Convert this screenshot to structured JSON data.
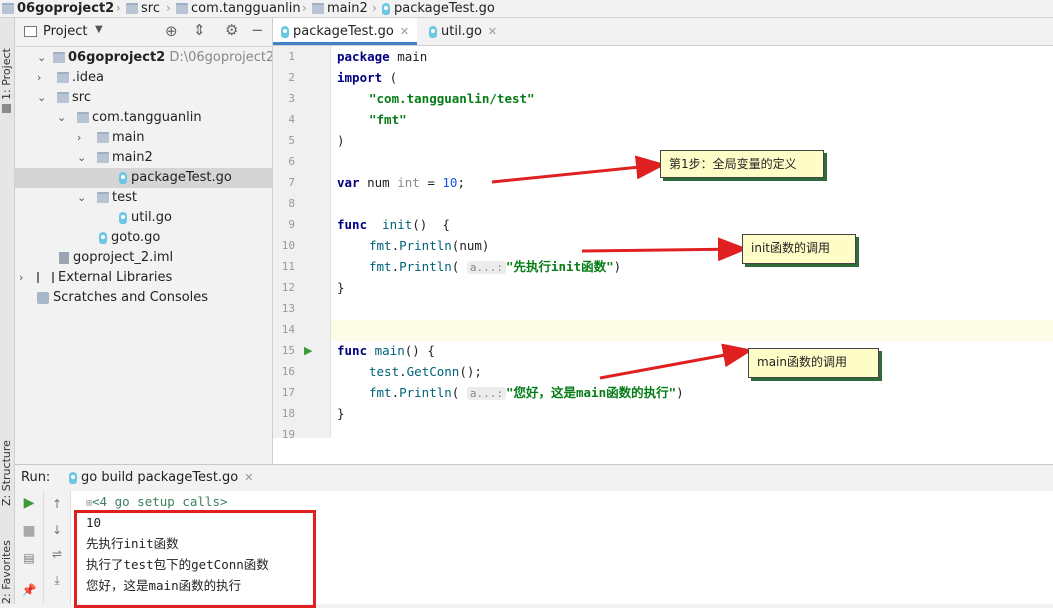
{
  "breadcrumb": {
    "items": [
      "06goproject2",
      "src",
      "com.tangguanlin",
      "main2",
      "packageTest.go"
    ]
  },
  "left_strip": {
    "project_tab": "1: Project",
    "structure_tab": "Z: Structure",
    "favorites_tab": "2: Favorites"
  },
  "project_panel": {
    "title": "Project",
    "tree": [
      {
        "label": "06goproject2",
        "extra": "D:\\06goproject2"
      },
      {
        "label": ".idea"
      },
      {
        "label": "src"
      },
      {
        "label": "com.tangguanlin"
      },
      {
        "label": "main"
      },
      {
        "label": "main2"
      },
      {
        "label": "packageTest.go"
      },
      {
        "label": "test"
      },
      {
        "label": "util.go"
      },
      {
        "label": "goto.go"
      },
      {
        "label": "goproject_2.iml"
      },
      {
        "label": "External Libraries"
      },
      {
        "label": "Scratches and Consoles"
      }
    ]
  },
  "editor": {
    "tabs": [
      {
        "label": "packageTest.go",
        "active": true
      },
      {
        "label": "util.go",
        "active": false
      }
    ],
    "line_numbers": [
      "1",
      "2",
      "3",
      "4",
      "5",
      "6",
      "7",
      "8",
      "9",
      "10",
      "11",
      "12",
      "13",
      "14",
      "15",
      "16",
      "17",
      "18",
      "19"
    ],
    "code": {
      "l1_kw": "package",
      "l1_rest": " main",
      "l2_kw": "import",
      "l2_rest": " (",
      "l3": "\"com.tangguanlin/test\"",
      "l4": "\"fmt\"",
      "l5": ")",
      "l7_kw": "var",
      "l7_name": " num ",
      "l7_type": "int",
      "l7_eq": " = ",
      "l7_num": "10",
      "l7_end": ";",
      "l9_kw": "func",
      "l9_name": "  init",
      "l9_rest": "()  {",
      "l10_pkg": "fmt",
      "l10_dot": ".",
      "l10_fn": "Println",
      "l10_args": "(num)",
      "l11_pkg": "fmt",
      "l11_dot": ".",
      "l11_fn": "Println",
      "l11_open": "( ",
      "l11_hint": "a...:",
      "l11_str": "\"先执行init函数\"",
      "l11_close": ")",
      "l12": "}",
      "l15_kw": "func",
      "l15_name": " main",
      "l15_rest": "() {",
      "l16_pkg": "test",
      "l16_dot": ".",
      "l16_fn": "GetConn",
      "l16_rest": "();",
      "l17_pkg": "fmt",
      "l17_dot": ".",
      "l17_fn": "Println",
      "l17_open": "( ",
      "l17_hint": "a...:",
      "l17_str": "\"您好，这是main函数的执行\"",
      "l17_close": ")",
      "l18": "}"
    }
  },
  "annotations": {
    "step1": "第1步：全局变量的定义",
    "init_call": "init函数的调用",
    "main_call": "main函数的调用"
  },
  "run_panel": {
    "label": "Run:",
    "tab": "go build packageTest.go",
    "output": [
      "<4 go setup calls>",
      "10",
      "先执行init函数",
      "执行了test包下的getConn函数",
      "您好，这是main函数的执行"
    ]
  },
  "colors": {
    "accent": "#4083c9",
    "keyword": "#000080",
    "string": "#067d17",
    "arrow": "#e02020",
    "callout_bg": "#fefdc8"
  }
}
